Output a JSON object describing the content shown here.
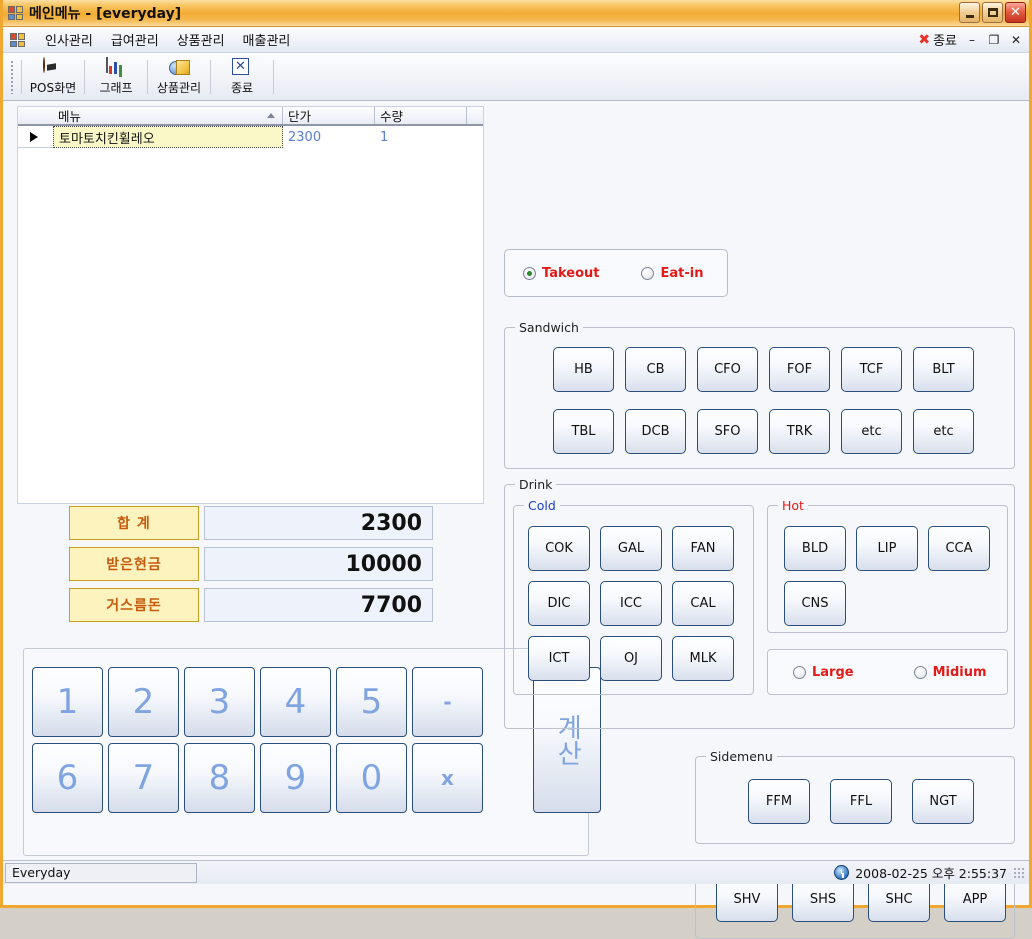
{
  "window": {
    "title": "메인메뉴 - [everyday]",
    "app_icon": "mdi-window-icon",
    "controls": {
      "minimize": "–",
      "maximize": "□",
      "close": "✕"
    },
    "border_color": "#f0a830"
  },
  "menubar": {
    "mdi_icon": "mdi-child-icon",
    "items": [
      "인사관리",
      "급여관리",
      "상품관리",
      "매출관리"
    ],
    "exit_label": "종료",
    "exit_icon": "red-x-icon",
    "mdi_minimize": "–",
    "mdi_restore": "❐",
    "mdi_close": "✕"
  },
  "toolbar": {
    "buttons": [
      {
        "label": "POS화면",
        "icon": "pos-screen-icon"
      },
      {
        "label": "그래프",
        "icon": "bar-chart-icon"
      },
      {
        "label": "상품관리",
        "icon": "products-icon"
      },
      {
        "label": "종료",
        "icon": "exit-x-icon"
      }
    ]
  },
  "grid": {
    "columns": [
      "메뉴",
      "단가",
      "수량"
    ],
    "sort_indicator_column": "메뉴",
    "rows": [
      {
        "menu": "토마토치킨휠레오",
        "price": "2300",
        "qty": "1"
      }
    ]
  },
  "totals": [
    {
      "label": "합  계",
      "value": "2300"
    },
    {
      "label": "받은현금",
      "value": "10000"
    },
    {
      "label": "거스름돈",
      "value": "7700"
    }
  ],
  "keypad": {
    "keys": [
      "1",
      "2",
      "3",
      "4",
      "5",
      "-",
      "6",
      "7",
      "8",
      "9",
      "0",
      "x"
    ],
    "calc_label": "계산"
  },
  "order_type": {
    "options": [
      {
        "label": "Takeout",
        "selected": true
      },
      {
        "label": "Eat-in",
        "selected": false
      }
    ]
  },
  "sandwich": {
    "legend": "Sandwich",
    "row1": [
      "HB",
      "CB",
      "CFO",
      "FOF",
      "TCF",
      "BLT"
    ],
    "row2": [
      "TBL",
      "DCB",
      "SFO",
      "TRK",
      "etc",
      "etc"
    ]
  },
  "drink": {
    "legend": "Drink",
    "cold": {
      "legend": "Cold",
      "legend_color": "#1a3fc4",
      "buttons": [
        "COK",
        "GAL",
        "FAN",
        "DIC",
        "ICC",
        "CAL",
        "ICT",
        "OJ",
        "MLK"
      ]
    },
    "hot": {
      "legend": "Hot",
      "legend_color": "#e01b15",
      "buttons": [
        "BLD",
        "LIP",
        "CCA",
        "CNS"
      ]
    },
    "size": {
      "options": [
        {
          "label": "Large",
          "selected": false
        },
        {
          "label": "Midium",
          "selected": false
        }
      ]
    }
  },
  "sidemenu": {
    "legend": "Sidemenu",
    "buttons": [
      "FFM",
      "FFL",
      "NGT"
    ]
  },
  "extra": {
    "buttons": [
      "SHV",
      "SHS",
      "SHC",
      "APP"
    ]
  },
  "statusbar": {
    "left_text": "Everyday",
    "clock_icon": "clock-icon",
    "datetime": "2008-02-25 오후 2:55:37"
  },
  "colors": {
    "accent_orange": "#f0a830",
    "radio_label_red": "#e31b18",
    "total_label_text": "#c75b0d",
    "total_label_bg": "#fdf3bf",
    "keypad_text": "#7fa4e0",
    "grid_row_bg": "#fbf8c7",
    "grid_value_text": "#5a7fcf",
    "button_border": "#2a4f7c"
  }
}
